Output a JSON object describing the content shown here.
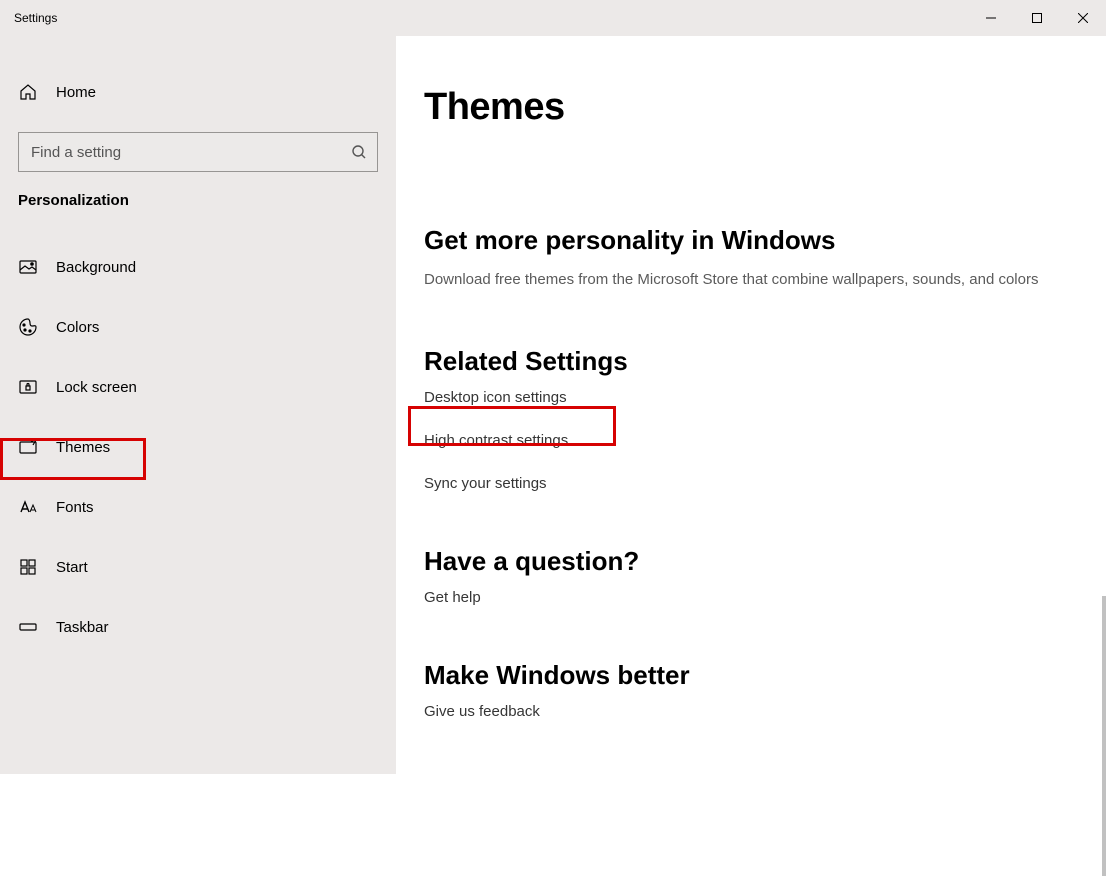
{
  "window": {
    "title": "Settings"
  },
  "sidebar": {
    "home": "Home",
    "search_placeholder": "Find a setting",
    "category": "Personalization",
    "items": [
      {
        "label": "Background"
      },
      {
        "label": "Colors"
      },
      {
        "label": "Lock screen"
      },
      {
        "label": "Themes"
      },
      {
        "label": "Fonts"
      },
      {
        "label": "Start"
      },
      {
        "label": "Taskbar"
      }
    ]
  },
  "main": {
    "title": "Themes",
    "sections": {
      "personality": {
        "heading": "Get more personality in Windows",
        "body": "Download free themes from the Microsoft Store that combine wallpapers, sounds, and colors"
      },
      "related": {
        "heading": "Related Settings",
        "links": [
          "Desktop icon settings",
          "High contrast settings",
          "Sync your settings"
        ]
      },
      "question": {
        "heading": "Have a question?",
        "link": "Get help"
      },
      "better": {
        "heading": "Make Windows better",
        "link": "Give us feedback"
      }
    }
  }
}
